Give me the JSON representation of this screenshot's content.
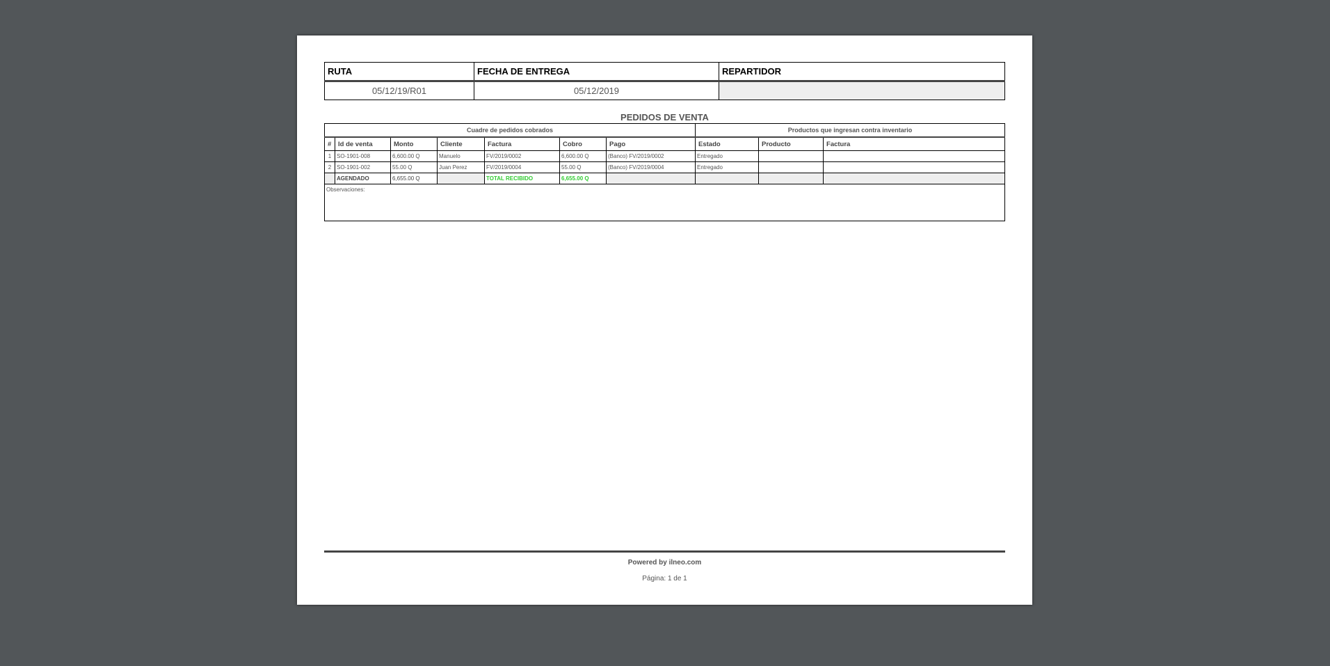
{
  "header": {
    "labels": [
      "RUTA",
      "FECHA DE ENTREGA",
      "REPARTIDOR"
    ],
    "values": [
      "05/12/19/R01",
      "05/12/2019",
      ""
    ]
  },
  "title": "PEDIDOS DE VENTA",
  "groups": {
    "left": "Cuadre de pedidos cobrados",
    "right": "Productos que ingresan contra inventario"
  },
  "columns": [
    "#",
    "Id de venta",
    "Monto",
    "Cliente",
    "Factura",
    "Cobro",
    "Pago",
    "Estado",
    "Producto",
    "Factura"
  ],
  "rows": [
    [
      "1",
      "SO-1901-008",
      "6,600.00 Q",
      "Manuelo",
      "FV/2019/0002",
      "6,600.00 Q",
      "(Banco) FV/2019/0002",
      "Entregado",
      "",
      ""
    ],
    [
      "2",
      "SO-1901-002",
      "55.00 Q",
      "Juan Perez",
      "FV/2019/0004",
      "55.00 Q",
      "(Banco) FV/2019/0004",
      "Entregado",
      "",
      ""
    ]
  ],
  "totals": {
    "scheduled_label": "AGENDADO",
    "scheduled_amount": "6,655.00 Q",
    "received_label": "TOTAL RECIBIDO",
    "received_amount": "6,655.00 Q"
  },
  "observations_label": "Observaciones:",
  "footer": {
    "powered_by": "Powered by ilneo.com",
    "page": "Página: 1 de 1"
  },
  "colors": {
    "viewer_bg": "#525659",
    "total_green": "#33cc33"
  }
}
